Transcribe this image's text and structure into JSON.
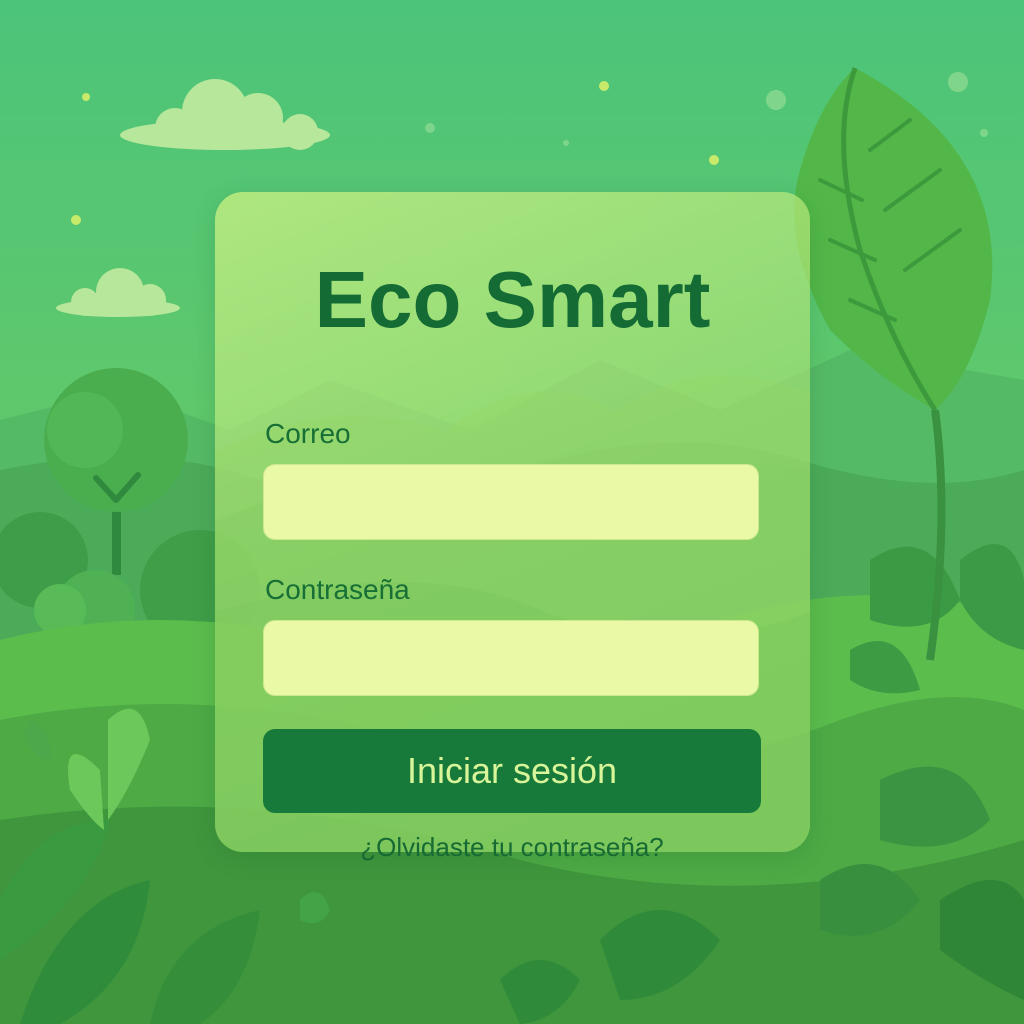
{
  "app": {
    "title": "Eco Smart"
  },
  "login_form": {
    "email_label": "Correo",
    "email_value": "",
    "password_label": "Contraseña",
    "password_value": "",
    "submit_label": "Iniciar sesión",
    "forgot_password_label": "¿Olvidaste tu contraseña?"
  },
  "colors": {
    "primary": "#187a3a",
    "title": "#146b33",
    "input_background": "#e9f9a6",
    "button_text": "#d9f59a",
    "background": "#4cc47a"
  },
  "icons": [
    "cloud-icon",
    "tree-icon",
    "leaf-icon"
  ]
}
